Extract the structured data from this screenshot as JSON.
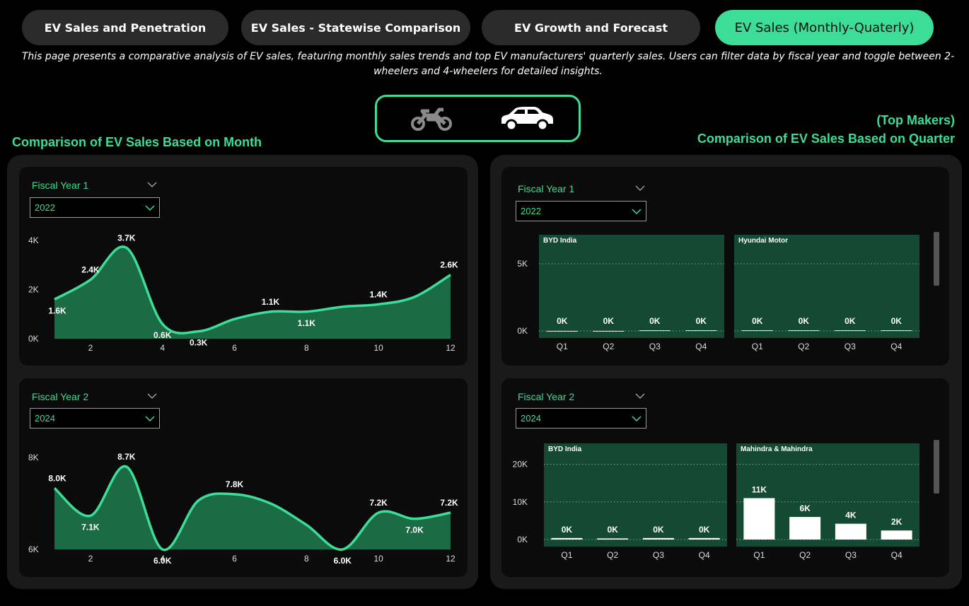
{
  "tabs": [
    {
      "label": "EV Sales and Penetration",
      "active": false
    },
    {
      "label": "EV Sales - Statewise Comparison",
      "active": false
    },
    {
      "label": "EV Growth and Forecast",
      "active": false
    },
    {
      "label": "EV Sales (Monthly-Quaterly)",
      "active": true
    }
  ],
  "description": "This page presents a comparative analysis of EV sales, featuring monthly sales trends and top EV manufacturers' quarterly sales. Users can filter data by fiscal year and toggle between 2-wheelers and 4-wheelers for detailed insights.",
  "toggle": {
    "options": [
      "2-wheeler",
      "4-wheeler"
    ],
    "selected": "4-wheeler",
    "icons": [
      "motorcycle-icon",
      "car-icon"
    ]
  },
  "left": {
    "title": "Comparison of EV Sales Based on Month",
    "fy1": {
      "label": "Fiscal Year 1",
      "value": "2022"
    },
    "fy2": {
      "label": "Fiscal Year 2",
      "value": "2024"
    }
  },
  "right": {
    "title_line1": "(Top Makers)",
    "title_line2": "Comparison of  EV Sales Based on Quarter",
    "fy1": {
      "label": "Fiscal Year 1",
      "value": "2022"
    },
    "fy2": {
      "label": "Fiscal Year 2",
      "value": "2024"
    }
  },
  "colors": {
    "accent": "#3ddc97",
    "area_fill": "#1b6b45",
    "panel_bg": "#144a33",
    "tab_bg": "#2b2b2b"
  },
  "chart_data": [
    {
      "type": "area",
      "x": [
        1,
        2,
        3,
        4,
        5,
        6,
        7,
        8,
        9,
        10,
        11,
        12
      ],
      "values": [
        1600,
        2400,
        3700,
        600,
        300,
        800,
        1100,
        1100,
        1300,
        1400,
        1700,
        2600
      ],
      "data_labels": {
        "1": "1.6K",
        "2": "2.4K",
        "3": "3.7K",
        "4": "0.6K",
        "5": "0.3K",
        "7": "1.1K",
        "8": "1.1K",
        "10": "1.4K",
        "12": "2.6K"
      },
      "ylim": [
        0,
        4000
      ],
      "y_ticks": [
        "0K",
        "2K",
        "4K"
      ],
      "x_ticks": [
        "2",
        "4",
        "6",
        "8",
        "10",
        "12"
      ],
      "grid": false
    },
    {
      "type": "area",
      "x": [
        1,
        2,
        3,
        4,
        5,
        6,
        7,
        8,
        9,
        10,
        11,
        12
      ],
      "values": [
        8000,
        7100,
        8700,
        6000,
        7600,
        7800,
        7500,
        6800,
        6000,
        7200,
        7000,
        7200
      ],
      "data_labels": {
        "1": "8.0K",
        "2": "7.1K",
        "3": "8.7K",
        "4": "6.0K",
        "6": "7.8K",
        "9": "6.0K",
        "10": "7.2K",
        "11": "7.0K",
        "12": "7.2K"
      },
      "ylim": [
        6000,
        9000
      ],
      "y_ticks": [
        "6K",
        "8K"
      ],
      "x_ticks": [
        "2",
        "4",
        "6",
        "8",
        "10",
        "12"
      ],
      "grid": false
    },
    {
      "type": "bar",
      "categories": [
        "Q1",
        "Q2",
        "Q3",
        "Q4"
      ],
      "series": [
        {
          "name": "BYD India",
          "values": [
            0,
            0,
            50,
            50
          ],
          "data_labels": [
            "0K",
            "0K",
            "0K",
            "0K"
          ]
        },
        {
          "name": "Hyundai Motor",
          "values": [
            50,
            50,
            50,
            50
          ],
          "data_labels": [
            "0K",
            "0K",
            "0K",
            "0K"
          ]
        }
      ],
      "ylim": [
        0,
        7000
      ],
      "y_ticks": [
        "0K",
        "5K"
      ],
      "grid": true
    },
    {
      "type": "bar",
      "categories": [
        "Q1",
        "Q2",
        "Q3",
        "Q4"
      ],
      "series": [
        {
          "name": "BYD India",
          "values": [
            400,
            300,
            400,
            400
          ],
          "data_labels": [
            "0K",
            "0K",
            "0K",
            "0K"
          ]
        },
        {
          "name": "Mahindra & Mahindra",
          "values": [
            11000,
            6000,
            4200,
            2400
          ],
          "data_labels": [
            "11K",
            "6K",
            "4K",
            "2K"
          ]
        }
      ],
      "ylim": [
        0,
        25000
      ],
      "y_ticks": [
        "0K",
        "10K",
        "20K"
      ],
      "grid": true
    }
  ]
}
